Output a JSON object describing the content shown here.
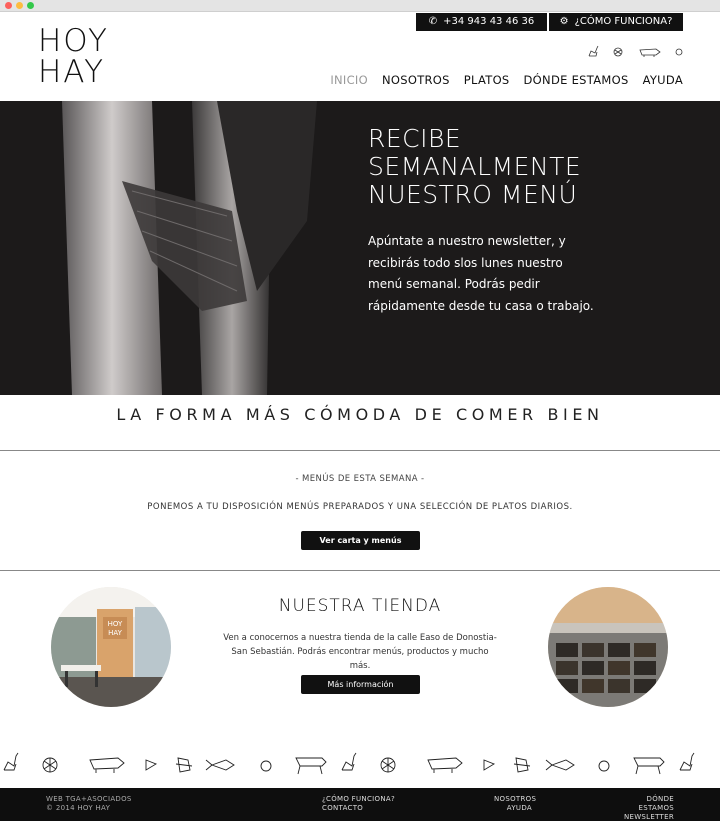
{
  "header": {
    "logo_line1": "HOY",
    "logo_line2": "HAY",
    "phone_label": "+34 943 43 46 36",
    "how_label": "¿CÓMO FUNCIONA?",
    "icons": [
      "goose-icon",
      "shell-icon",
      "pig-icon",
      "egg-icon"
    ]
  },
  "nav": {
    "items": [
      "INICIO",
      "NOSOTROS",
      "PLATOS",
      "DÓNDE ESTAMOS",
      "AYUDA"
    ],
    "active": "INICIO"
  },
  "hero": {
    "title_line1": "RECIBE",
    "title_line2": "SEMANALMENTE",
    "title_line3": "NUESTRO MENÚ",
    "text": "Apúntate a nuestro newsletter, y recibirás todo slos lunes nuestro menú semanal. Podrás pedir rápidamente desde tu casa o trabajo."
  },
  "slogan": "LA FORMA MÁS CÓMODA DE COMER BIEN",
  "menus": {
    "kicker": "- MENÚS DE ESTA SEMANA -",
    "description": "PONEMOS A TU DISPOSICIÓN MENÚS PREPARADOS Y UNA SELECCIÓN DE PLATOS DIARIOS.",
    "button": "Ver carta y menús"
  },
  "store": {
    "title": "NUESTRA TIENDA",
    "text": "Ven a conocernos a nuestra tienda de la calle Easo de Donostia-San Sebastián. Podrás encontrar menús, productos y mucho más.",
    "button": "Más información",
    "photo_sign_line1": "HOY",
    "photo_sign_line2": "HAY"
  },
  "footer": {
    "credit": "WEB TGA+ASOCIADOS",
    "copyright": "© 2014 HOY HAY",
    "link_how": "¿CÓMO FUNCIONA?",
    "link_contact": "CONTACTO",
    "link_about": "NOSOTROS",
    "link_help": "AYUDA",
    "link_where": "DÓNDE ESTAMOS",
    "link_newsletter": "NEWSLETTER"
  },
  "colors": {
    "dark": "#111111",
    "hero_bg": "#1c1a1a",
    "footer_bg": "#0e0e0e",
    "nav_active": "#999999"
  }
}
